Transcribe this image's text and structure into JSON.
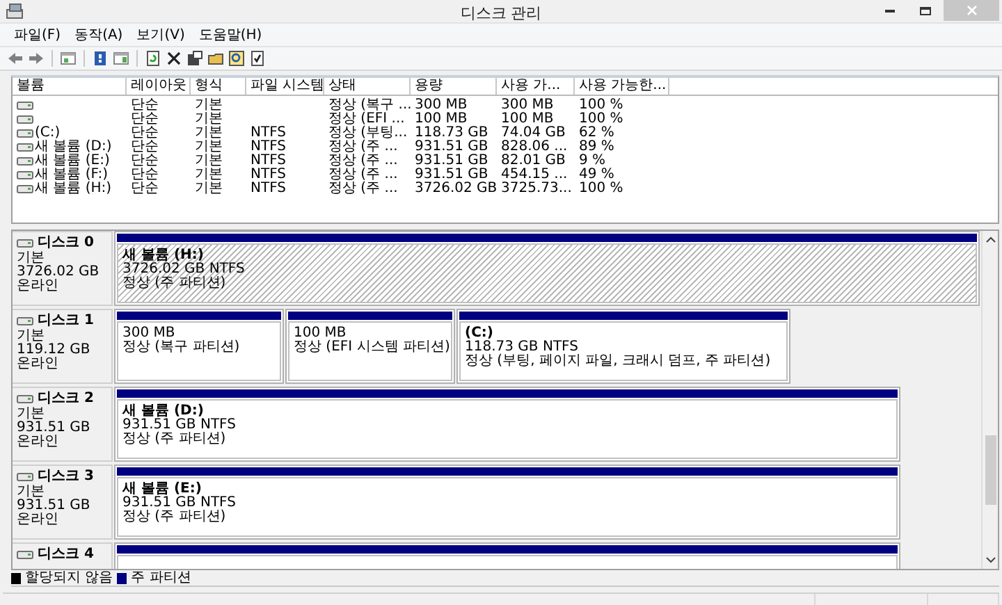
{
  "window": {
    "title": "디스크 관리"
  },
  "menu": [
    {
      "label": "파일(F)"
    },
    {
      "label": "동작(A)"
    },
    {
      "label": "보기(V)"
    },
    {
      "label": "도움말(H)"
    }
  ],
  "volumes": {
    "columns": [
      "볼륨",
      "레이아웃",
      "형식",
      "파일 시스템",
      "상태",
      "용량",
      "사용 가...",
      "사용 가능한..."
    ],
    "rows": [
      {
        "layout": "단순",
        "type": "기본",
        "status": "정상 (복구 ...",
        "capacity": "300 MB",
        "free_space": "300 MB",
        "percent_free": "100 %"
      },
      {
        "layout": "단순",
        "type": "기본",
        "status": "정상 (EFI ...",
        "capacity": "100 MB",
        "free_space": "100 MB",
        "percent_free": "100 %"
      },
      {
        "volume": "(C:)",
        "layout": "단순",
        "type": "기본",
        "file_system": "NTFS",
        "status": "정상 (부팅...",
        "capacity": "118.73 GB",
        "free_space": "74.04 GB",
        "percent_free": "62 %"
      },
      {
        "volume": "새 볼륨 (D:)",
        "layout": "단순",
        "type": "기본",
        "file_system": "NTFS",
        "status": "정상 (주 ...",
        "capacity": "931.51 GB",
        "free_space": "828.06 ...",
        "percent_free": "89 %"
      },
      {
        "volume": "새 볼륨 (E:)",
        "layout": "단순",
        "type": "기본",
        "file_system": "NTFS",
        "status": "정상 (주 ...",
        "capacity": "931.51 GB",
        "free_space": "82.01 GB",
        "percent_free": "9 %"
      },
      {
        "volume": "새 볼륨 (F:)",
        "layout": "단순",
        "type": "기본",
        "file_system": "NTFS",
        "status": "정상 (주 ...",
        "capacity": "931.51 GB",
        "free_space": "454.15 ...",
        "percent_free": "49 %"
      },
      {
        "volume": "새 볼륨 (H:)",
        "layout": "단순",
        "type": "기본",
        "file_system": "NTFS",
        "status": "정상 (주 ...",
        "capacity": "3726.02 GB",
        "free_space": "3725.73...",
        "percent_free": "100 %"
      }
    ]
  },
  "disks": [
    {
      "name": "디스크 0",
      "type": "기본",
      "size": "3726.02 GB",
      "status": "온라인",
      "partitions": [
        {
          "label": "새 볼륨  (H:)",
          "size": "3726.02 GB NTFS",
          "status": "정상 (주 파티션)",
          "selected": true
        }
      ]
    },
    {
      "name": "디스크 1",
      "type": "기본",
      "size": "119.12 GB",
      "status": "온라인",
      "partitions": [
        {
          "size": "300 MB",
          "status": "정상 (복구 파티션)",
          "selected": false
        },
        {
          "size": "100 MB",
          "status": "정상 (EFI 시스템 파티션)",
          "selected": false
        },
        {
          "label": "(C:)",
          "size": "118.73 GB NTFS",
          "status": "정상 (부팅, 페이지 파일, 크래시 덤프, 주 파티션)",
          "selected": false
        }
      ]
    },
    {
      "name": "디스크 2",
      "type": "기본",
      "size": "931.51 GB",
      "status": "온라인",
      "partitions": [
        {
          "label": "새 볼륨  (D:)",
          "size": "931.51 GB NTFS",
          "status": "정상 (주 파티션)",
          "selected": false
        }
      ]
    },
    {
      "name": "디스크 3",
      "type": "기본",
      "size": "931.51 GB",
      "status": "온라인",
      "partitions": [
        {
          "label": "새 볼륨  (E:)",
          "size": "931.51 GB NTFS",
          "status": "정상 (주 파티션)",
          "selected": false
        }
      ]
    },
    {
      "name": "디스크 4",
      "partitions": [
        {
          "selected": false
        }
      ]
    }
  ],
  "legend": [
    {
      "label": "할당되지 않음",
      "color": "#000000"
    },
    {
      "label": "주 파티션",
      "color": "#000080"
    }
  ]
}
